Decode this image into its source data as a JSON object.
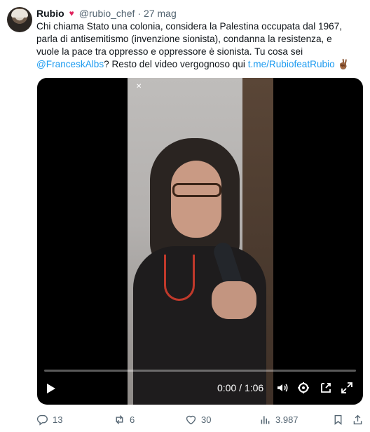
{
  "author": {
    "name": "Rubio",
    "badge": "♥",
    "handle": "@rubio_chef",
    "separator": "·",
    "date": "27 mag"
  },
  "tweet": {
    "line1": "Chi chiama Stato una colonia, considera la Palestina occupata dal 1967,",
    "line2": "parla di antisemitismo (invenzione sionista), condanna la resistenza, e",
    "line3": "vuole la pace tra oppresso e oppressore è sionista. Tu cosa sei",
    "mention": "@FranceskAlbs",
    "line4_mid": "? Resto del video vergognoso qui ",
    "link": "t.me/RubiofeatRubio",
    "emoji": "✌🏾"
  },
  "video": {
    "time": "0:00 / 1:06",
    "progress": 0,
    "icons": [
      "play-icon",
      "volume-icon",
      "settings-icon",
      "picture-in-picture-icon",
      "fullscreen-icon"
    ]
  },
  "actions": {
    "replies": "13",
    "reposts": "6",
    "likes": "30",
    "views": "3.987"
  },
  "colors": {
    "link": "#1d9bf0",
    "secondary_text": "#536471",
    "heart_badge": "#e0245e"
  }
}
